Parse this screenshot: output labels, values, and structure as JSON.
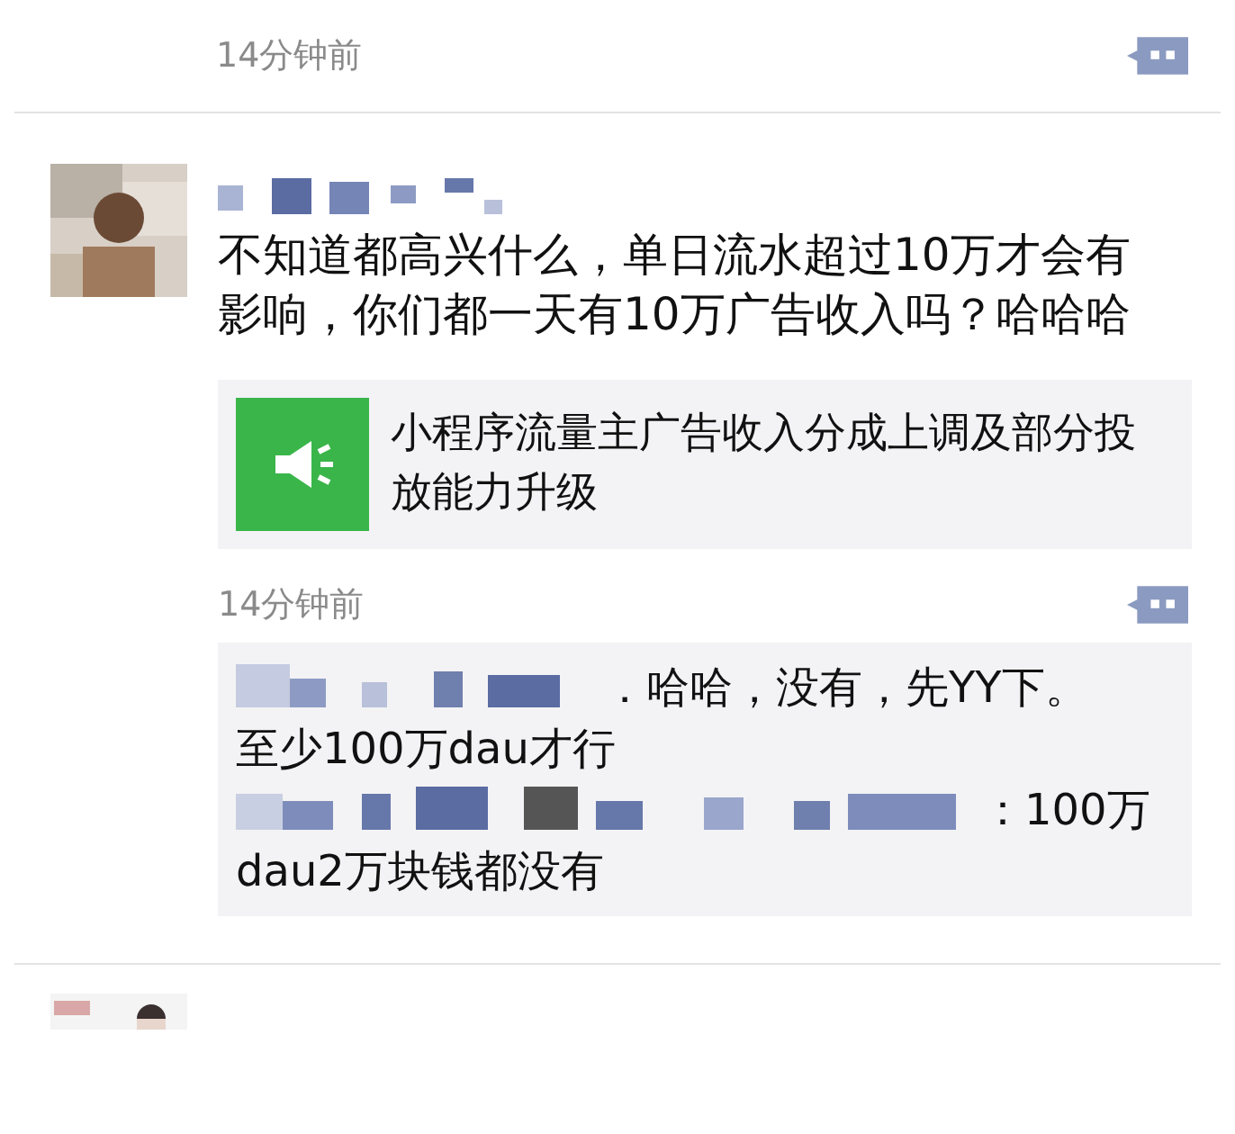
{
  "top_time": "14分钟前",
  "post": {
    "text": "不知道都高兴什么，单日流水超过10万才会有影响，你们都一天有10万广告收入吗？哈哈哈",
    "share": {
      "title": "小程序流量主广告收入分成上调及部分投放能力升级"
    },
    "time": "14分钟前",
    "comments": [
      {
        "lines": [
          "．哈哈，没有，先YY下。",
          "至少100万dau才行"
        ]
      },
      {
        "lines": [
          "：100万",
          "dau2万块钱都没有"
        ]
      }
    ]
  }
}
